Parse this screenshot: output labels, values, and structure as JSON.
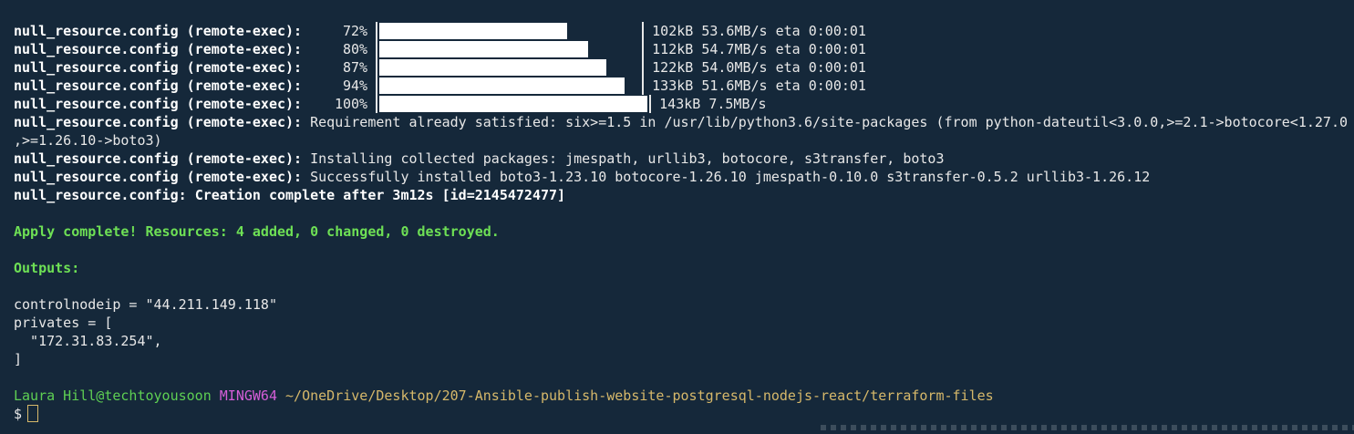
{
  "resource": "null_resource.config",
  "exec_tag": "(remote-exec):",
  "progress": [
    {
      "pct": "72%",
      "fraction": 0.72,
      "stats": "102kB 53.6MB/s eta 0:00:01"
    },
    {
      "pct": "80%",
      "fraction": 0.8,
      "stats": "112kB 54.7MB/s eta 0:00:01"
    },
    {
      "pct": "87%",
      "fraction": 0.87,
      "stats": "122kB 54.0MB/s eta 0:00:01"
    },
    {
      "pct": "94%",
      "fraction": 0.94,
      "stats": "133kB 51.6MB/s eta 0:00:01"
    },
    {
      "pct": "100%",
      "fraction": 1.0,
      "stats": "143kB 7.5MB/s"
    }
  ],
  "log": {
    "requirement": "Requirement already satisfied: six>=1.5 in /usr/lib/python3.6/site-packages (from python-dateutil<3.0.0,>=2.1->botocore<1.27.0",
    "requirement_wrap": ",>=1.26.10->boto3)",
    "installing": "Installing collected packages: jmespath, urllib3, botocore, s3transfer, boto3",
    "installed": "Successfully installed boto3-1.23.10 botocore-1.26.10 jmespath-0.10.0 s3transfer-0.5.2 urllib3-1.26.12",
    "creation_prefix": "null_resource.config:",
    "creation": "Creation complete after 3m12s [id=2145472477]"
  },
  "apply_complete": "Apply complete! Resources: 4 added, 0 changed, 0 destroyed.",
  "outputs_label": "Outputs:",
  "outputs": {
    "control_line": "controlnodeip = \"44.211.149.118\"",
    "privates_open": "privates = [",
    "private_ip": "  \"172.31.83.254\",",
    "privates_close": "]"
  },
  "prompt": {
    "user_host": "Laura Hill@techtoyousoon",
    "system": "MINGW64",
    "path": "~/OneDrive/Desktop/207-Ansible-publish-website-postgresql-nodejs-react/terraform-files",
    "symbol": "$"
  },
  "colors": {
    "background": "#15283a",
    "success_green": "#6ee055",
    "prompt_user": "#5ecf53",
    "prompt_system": "#d55ed8",
    "prompt_path": "#d6b86a"
  }
}
